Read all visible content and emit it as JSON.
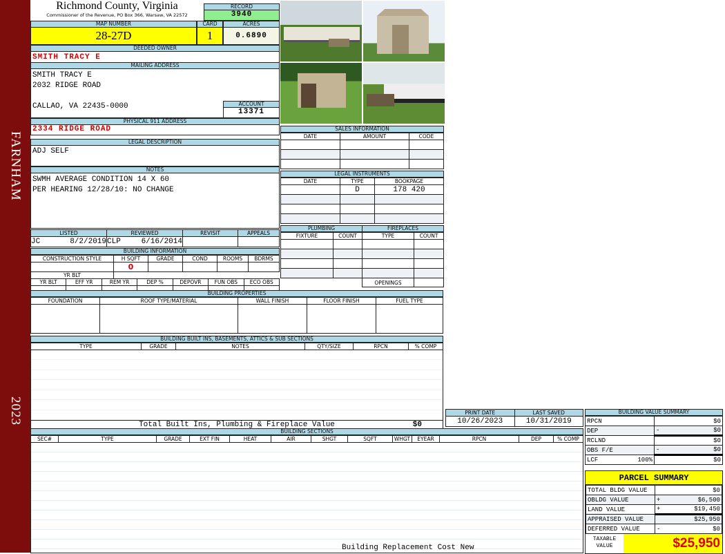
{
  "sidebar": {
    "district": "FARNHAM",
    "year": "2023"
  },
  "header": {
    "title": "Richmond County, Virginia",
    "subtitle": "Commissioner of the Revenue, PO Box 366, Warsaw, VA 22572",
    "record_label": "RECORD",
    "record": "3940"
  },
  "parcel": {
    "map_label": "MAP NUMBER",
    "map": "28-27D",
    "card_label": "CARD",
    "card": "1",
    "acres_label": "ACRES",
    "acres": "0.6890"
  },
  "owner": {
    "label": "DEEDED OWNER",
    "value": "SMITH TRACY E"
  },
  "mailing": {
    "label": "MAILING ADDRESS",
    "line1": "SMITH TRACY E",
    "line2": "2032 RIDGE ROAD",
    "line3": "CALLAO, VA 22435-0000",
    "account_label": "ACCOUNT",
    "account": "13371"
  },
  "physical": {
    "label": "PHYSICAL 911 ADDRESS",
    "value": "2334 RIDGE ROAD"
  },
  "legal": {
    "label": "LEGAL DESCRIPTION",
    "value": "ADJ SELF"
  },
  "notes": {
    "label": "NOTES",
    "line1": "SWMH AVERAGE CONDITION 14 X 60",
    "line2": "PER HEARING 12/28/10: NO CHANGE"
  },
  "review": {
    "listed_label": "LISTED",
    "reviewed_label": "REVIEWED",
    "revisit_label": "REVISIT",
    "appeals_label": "APPEALS",
    "listed_by": "JC",
    "listed_date": "8/2/2019",
    "reviewed_by": "CLP",
    "reviewed_date": "6/16/2014"
  },
  "building_info": {
    "label": "BUILDING INFORMATION",
    "row1": [
      "CONSTRUCTION STYLE",
      "H SQFT",
      "GRADE",
      "COND",
      "ROOMS",
      "BDRMS"
    ],
    "hsqft": "0",
    "row2": [
      "YR BLT",
      "EFF YR",
      "REM YR",
      "DEP %",
      "DEPOVR",
      "FUN OBS",
      "ECO OBS"
    ]
  },
  "sales": {
    "label": "SALES INFORMATION",
    "cols": [
      "DATE",
      "AMOUNT",
      "CODE"
    ]
  },
  "instruments": {
    "label": "LEGAL INSTRUMENTS",
    "cols": [
      "DATE",
      "TYPE",
      "BOOKPAGE"
    ],
    "type": "D",
    "bookpage": "178 420"
  },
  "plumbing": {
    "label": "PLUMBING",
    "cols": [
      "FIXTURE",
      "COUNT"
    ]
  },
  "fireplaces": {
    "label": "FIREPLACES",
    "cols": [
      "TYPE",
      "COUNT"
    ],
    "openings": "OPENINGS"
  },
  "properties": {
    "label": "BUILDING PROPERTIES",
    "cols": [
      "FOUNDATION",
      "ROOF TYPE/MATERIAL",
      "WALL FINISH",
      "FLOOR FINISH",
      "FUEL TYPE"
    ]
  },
  "builtins": {
    "label": "BUILDING BUILT INS, BASEMENTS, ATTICS & SUB SECTIONS",
    "cols": [
      "TYPE",
      "GRADE",
      "NOTES",
      "QTY/SIZE",
      "RPCN",
      "% COMP"
    ],
    "total_label": "Total Built Ins, Plumbing & Fireplace Value",
    "total": "$0"
  },
  "dates": {
    "print_label": "PRINT DATE",
    "print": "10/26/2023",
    "saved_label": "LAST SAVED",
    "saved": "10/31/2019"
  },
  "sections": {
    "label": "BUILDING SECTIONS",
    "cols": [
      "SEC#",
      "TYPE",
      "GRADE",
      "EXT FIN",
      "HEAT",
      "AIR",
      "SHGT",
      "SQFT",
      "WHGT",
      "EYEAR",
      "RPCN",
      "DEP",
      "% COMP"
    ],
    "footer": "Building Replacement Cost New"
  },
  "value_summary": {
    "label": "BUILDING VALUE SUMMARY",
    "rows": [
      {
        "k": "RPCN",
        "s": "",
        "v": "$0"
      },
      {
        "k": "DEP",
        "s": "-",
        "v": "$0"
      },
      {
        "k": "RCLND",
        "s": "",
        "v": "$0"
      },
      {
        "k": "OBS F/E",
        "s": "-",
        "v": "$0"
      },
      {
        "k": "LCF",
        "pct": "100%",
        "s": "",
        "v": "$0"
      }
    ]
  },
  "parcel_summary": {
    "label": "PARCEL SUMMARY",
    "rows": [
      {
        "k": "TOTAL BLDG VALUE",
        "s": "",
        "v": "$0"
      },
      {
        "k": "OBLDG VALUE",
        "s": "+",
        "v": "$6,500"
      },
      {
        "k": "LAND VALUE",
        "s": "+",
        "v": "$19,450"
      },
      {
        "k": "APPRAISED VALUE",
        "s": "",
        "v": "$25,950"
      },
      {
        "k": "DEFERRED VALUE",
        "s": "-",
        "v": "$0"
      }
    ],
    "taxable_label": "TAXABLE VALUE",
    "taxable": "$25,950"
  }
}
